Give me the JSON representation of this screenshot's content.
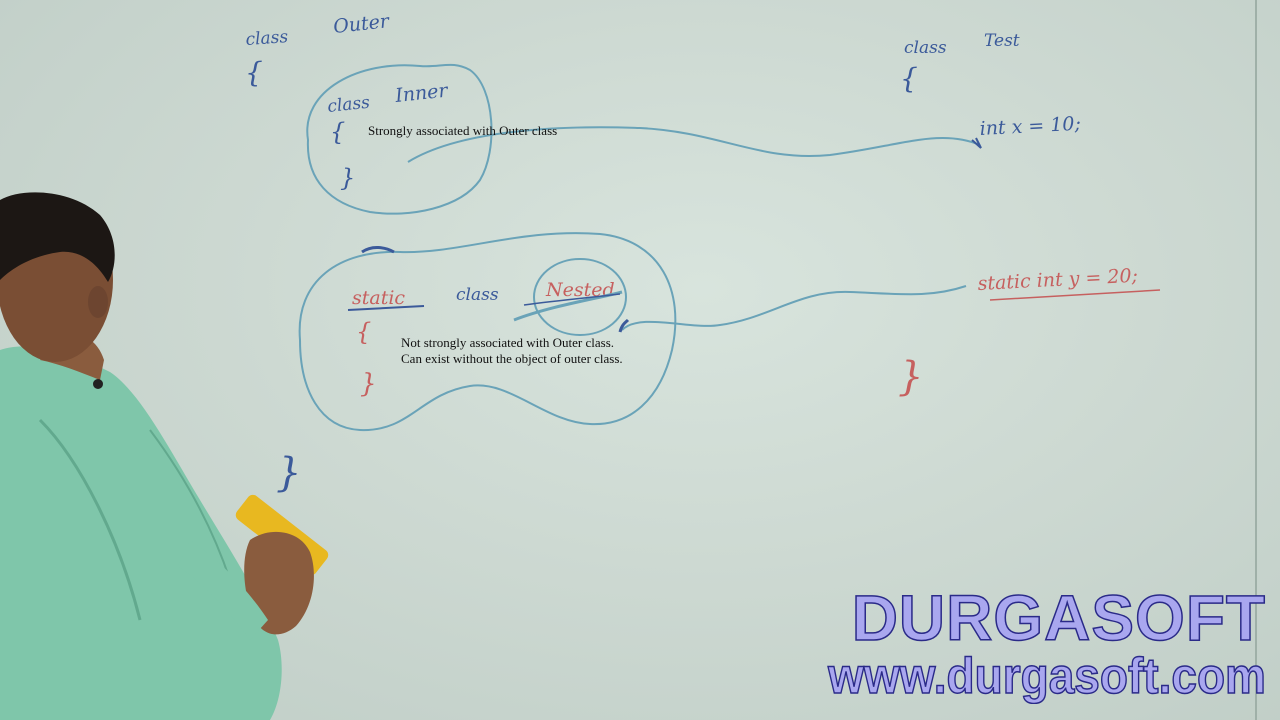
{
  "whiteboard": {
    "outer_class": {
      "keyword": "class",
      "name": "Outer"
    },
    "test_class": {
      "keyword": "class",
      "name": "Test"
    },
    "inner_class": {
      "keyword": "class",
      "name": "Inner"
    },
    "nested_class": {
      "modifier": "static",
      "keyword": "class",
      "name": "Nested"
    },
    "test_instance_member": "int x = 10;",
    "test_static_member": "static int y = 20;",
    "open_brace": "{",
    "close_brace": "}"
  },
  "captions": {
    "inner": "Strongly associated with Outer class",
    "nested_line1": "Not strongly associated with Outer class.",
    "nested_line2": "Can exist without the object of outer class."
  },
  "watermark": {
    "name": "DURGASOFT",
    "url": "www.durgasoft.com"
  },
  "colors": {
    "ink_blue": "#3b5a9a",
    "ink_red": "#c6605f",
    "connector_blue": "#6aa3b8",
    "watermark_fill": "#a9a7ef",
    "watermark_stroke": "#2a2a88"
  },
  "objects": {
    "presenter": "person-writing-on-whiteboard",
    "eraser": "yellow-whiteboard-eraser"
  }
}
